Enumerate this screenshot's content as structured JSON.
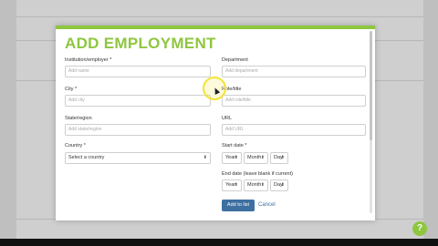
{
  "modal": {
    "title": "ADD EMPLOYMENT",
    "fields": {
      "institution_label": "Institution/employer *",
      "institution_placeholder": "Add name",
      "department_label": "Department",
      "department_placeholder": "Add department",
      "city_label": "City *",
      "city_placeholder": "Add city",
      "role_label": "Role/title",
      "role_placeholder": "Add role/title",
      "state_label": "State/region",
      "state_placeholder": "Add state/region",
      "url_label": "URL",
      "url_placeholder": "Add URL",
      "country_label": "Country *",
      "country_value": "Select a country",
      "start_label": "Start date *",
      "end_label": "End date (leave blank if current)",
      "year": "Year",
      "month": "Month",
      "day": "Day"
    },
    "add_button": "Add to list",
    "cancel_link": "Cancel"
  },
  "help_icon": "?",
  "colors": {
    "accent": "#8ec63f",
    "button": "#3d6fa0",
    "cursor_ring": "#f3e436"
  }
}
